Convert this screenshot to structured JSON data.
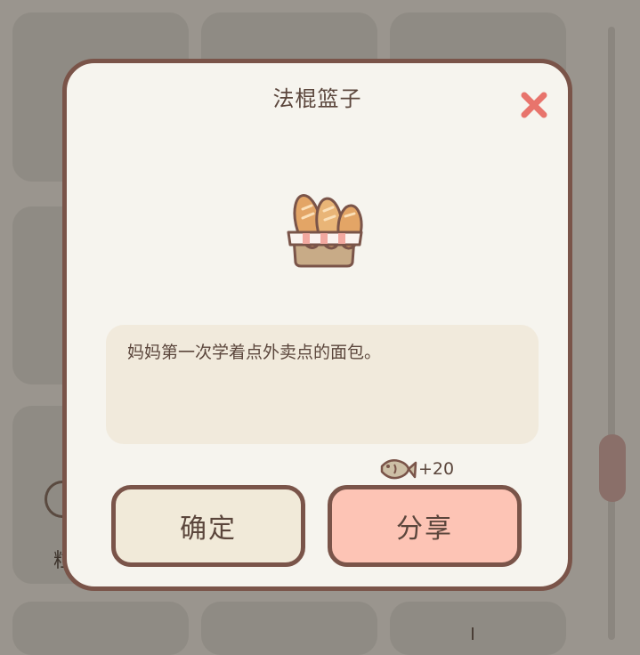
{
  "dialog": {
    "title": "法棍篮子",
    "description": "妈妈第一次学着点外卖点的面包。",
    "reward": {
      "icon": "fish-icon",
      "text": "+20"
    },
    "buttons": {
      "confirm_label": "确定",
      "share_label": "分享"
    },
    "close_icon": "close-icon",
    "item_image": "baguette-basket-image"
  },
  "background": {
    "partial_label": "粒"
  },
  "colors": {
    "dialog_bg": "#f6f4ee",
    "dialog_border": "#7a5449",
    "close_red": "#e8746c",
    "confirm_bg": "#f1ead9",
    "share_bg": "#fdc4b5",
    "text": "#5b463c",
    "overlay": "#9a958e"
  }
}
